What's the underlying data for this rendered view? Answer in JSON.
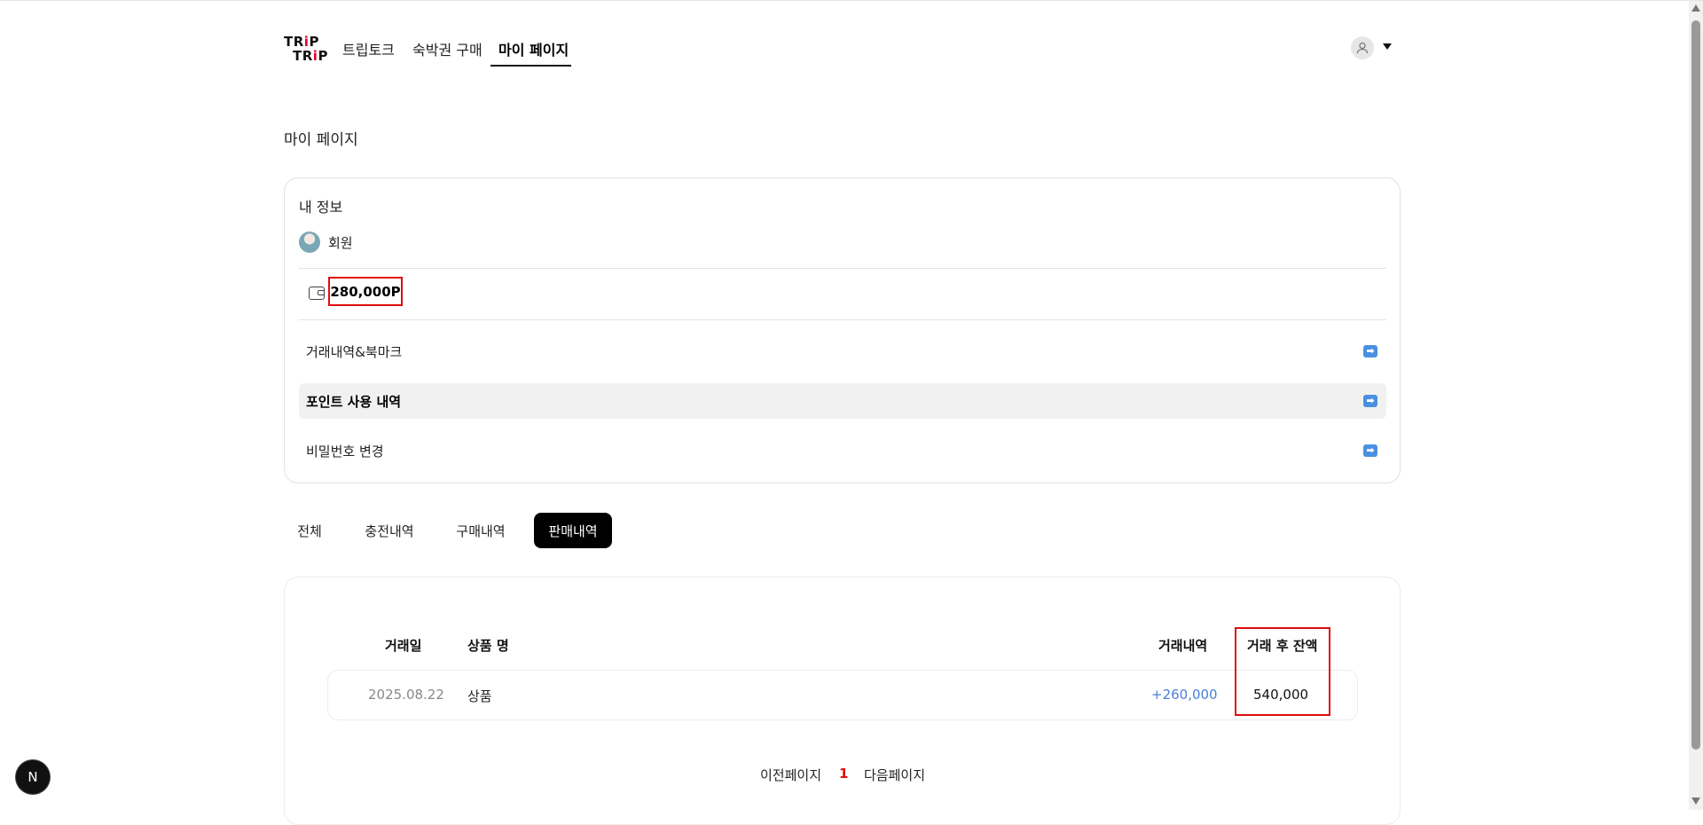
{
  "header": {
    "logo": {
      "line1_a": "TR",
      "line1_b": "i",
      "line1_c": "P",
      "line2_a": "TR",
      "line2_b": "i",
      "line2_c": "P"
    },
    "nav": [
      "트립토크",
      "숙박권 구매",
      "마이 페이지"
    ],
    "active_nav": "마이 페이지",
    "user_icon": "user-avatar-icon"
  },
  "page_title": "마이 페이지",
  "info_card": {
    "title": "내 정보",
    "member_label": "회원",
    "points": "280,000P",
    "menu": [
      {
        "label": "거래내역&북마크",
        "icon": "arrow-right-icon"
      },
      {
        "label": "포인트 사용 내역",
        "icon": "arrow-right-icon"
      },
      {
        "label": "비밀번호 변경",
        "icon": "arrow-right-icon"
      }
    ],
    "active_menu": "포인트 사용 내역"
  },
  "tabs": [
    "전체",
    "충전내역",
    "구매내역",
    "판매내역"
  ],
  "active_tab": "판매내역",
  "table": {
    "headers": [
      "거래일",
      "상품 명",
      "거래내역",
      "거래 후 잔액"
    ],
    "rows": [
      {
        "date": "2025.08.22",
        "product": "상품",
        "amount": "+260,000",
        "balance": "540,000"
      }
    ]
  },
  "pagination": {
    "prev": "이전페이지",
    "current": "1",
    "next": "다음페이지"
  },
  "dev_badge": "N",
  "colors": {
    "accent_blue": "#4a7fd6",
    "highlight_red": "#e00d0d",
    "active_tab_bg": "#000000"
  }
}
